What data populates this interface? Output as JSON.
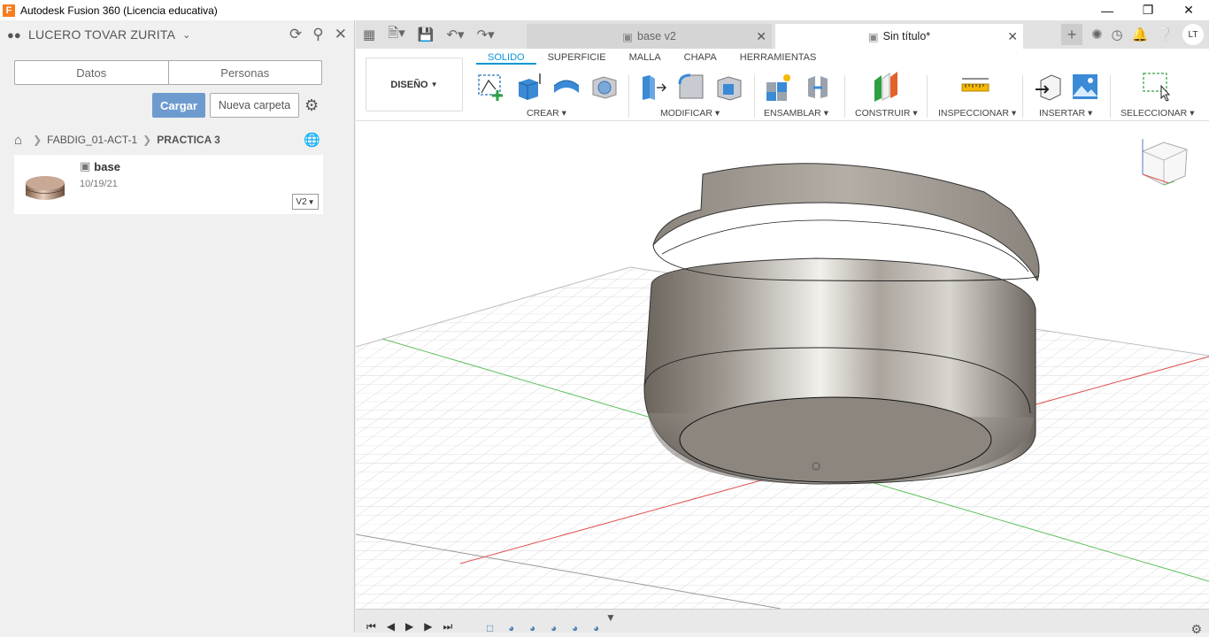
{
  "window": {
    "title": "Autodesk Fusion 360 (Licencia educativa)",
    "logo": "F"
  },
  "datapanel": {
    "user": "LUCERO TOVAR ZURITA",
    "tabs": [
      "Datos",
      "Personas"
    ],
    "upload_label": "Cargar",
    "new_folder_label": "Nueva carpeta",
    "breadcrumbs": [
      "FABDIG_01-ACT-1",
      "PRACTICA 3"
    ],
    "file": {
      "name": "base",
      "date": "10/19/21",
      "version": "V2"
    }
  },
  "tabs": [
    {
      "label": "base v2"
    },
    {
      "label": "Sin título*"
    }
  ],
  "user_initials": "LT",
  "toolbar": {
    "workspace": "DISEÑO",
    "workspace_tabs": [
      "SOLIDO",
      "SUPERFICIE",
      "MALLA",
      "CHAPA",
      "HERRAMIENTAS"
    ],
    "groups": [
      "CREAR",
      "MODIFICAR",
      "ENSAMBLAR",
      "CONSTRUIR",
      "INSPECCIONAR",
      "INSERTAR",
      "SELECCIONAR"
    ]
  },
  "colors": {
    "accent": "#0696d7",
    "upload": "#6e9bcf",
    "x_axis": "#e05050",
    "y_axis": "#60c060"
  }
}
